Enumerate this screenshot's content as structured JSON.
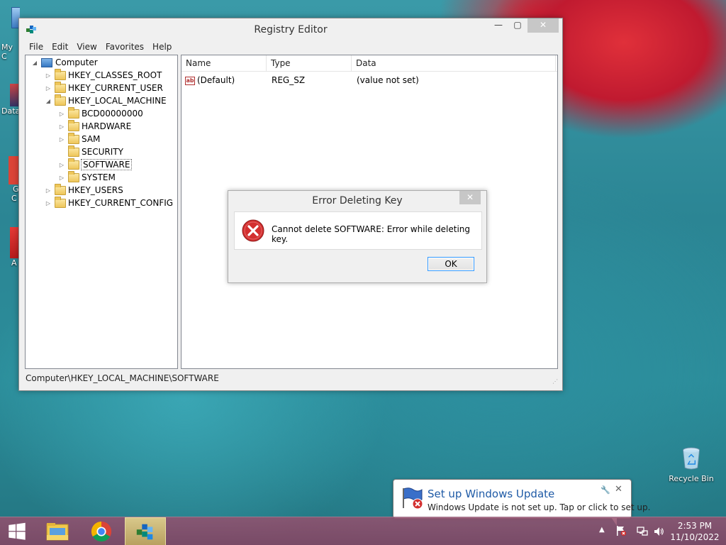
{
  "desktop": {
    "icons": [
      {
        "label": "Recycle Bin"
      }
    ],
    "partial_labels": [
      "My C",
      "Data",
      "G",
      "C",
      "A"
    ]
  },
  "registry_window": {
    "title": "Registry Editor",
    "menu": [
      "File",
      "Edit",
      "View",
      "Favorites",
      "Help"
    ],
    "tree": {
      "root": "Computer",
      "items": [
        {
          "label": "HKEY_CLASSES_ROOT",
          "level": 1,
          "expander": "▷"
        },
        {
          "label": "HKEY_CURRENT_USER",
          "level": 1,
          "expander": "▷"
        },
        {
          "label": "HKEY_LOCAL_MACHINE",
          "level": 1,
          "expander": "◢"
        },
        {
          "label": "BCD00000000",
          "level": 2,
          "expander": "▷"
        },
        {
          "label": "HARDWARE",
          "level": 2,
          "expander": "▷"
        },
        {
          "label": "SAM",
          "level": 2,
          "expander": "▷"
        },
        {
          "label": "SECURITY",
          "level": 2,
          "expander": ""
        },
        {
          "label": "SOFTWARE",
          "level": 2,
          "expander": "▷",
          "selected": true
        },
        {
          "label": "SYSTEM",
          "level": 2,
          "expander": "▷"
        },
        {
          "label": "HKEY_USERS",
          "level": 1,
          "expander": "▷"
        },
        {
          "label": "HKEY_CURRENT_CONFIG",
          "level": 1,
          "expander": "▷"
        }
      ]
    },
    "list": {
      "columns": [
        "Name",
        "Type",
        "Data"
      ],
      "rows": [
        {
          "name": "(Default)",
          "type": "REG_SZ",
          "data": "(value not set)"
        }
      ]
    },
    "status_path": "Computer\\HKEY_LOCAL_MACHINE\\SOFTWARE"
  },
  "error_dialog": {
    "title": "Error Deleting Key",
    "message": "Cannot delete SOFTWARE:  Error while deleting key.",
    "ok_label": "OK"
  },
  "notification": {
    "title": "Set up Windows Update",
    "text": "Windows Update is not set up. Tap or click to set up."
  },
  "taskbar": {
    "time": "2:53 PM",
    "date": "11/10/2022"
  },
  "colors": {
    "accent_blue": "#1e5aa6",
    "error_red": "#c62828",
    "selection_outline": "#3399ff"
  }
}
